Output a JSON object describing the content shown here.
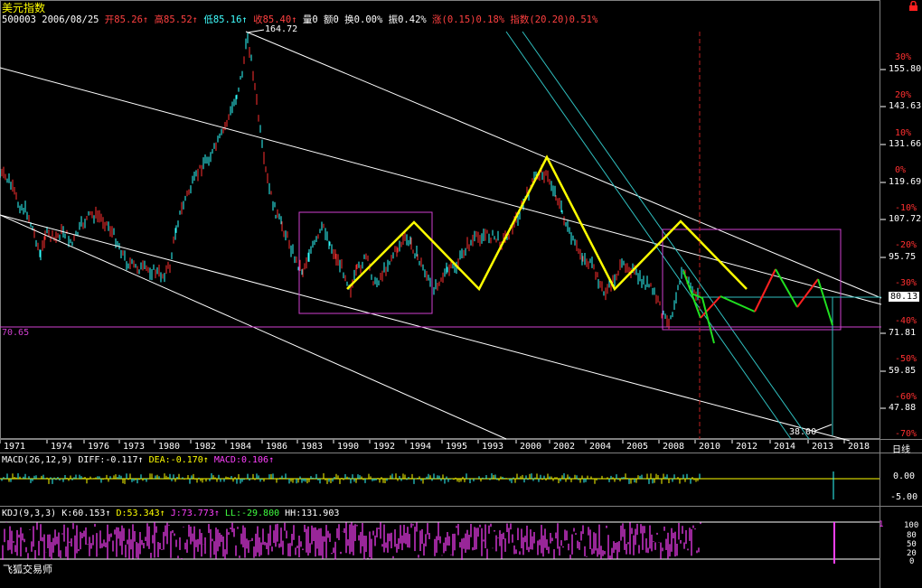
{
  "window_title": "美元指数",
  "info_bar": {
    "code_date": "500003 2006/08/25",
    "open": "开85.26↑",
    "high": "高85.52↑",
    "low": "低85.16↑",
    "close": "收85.40↑",
    "volume": "量0",
    "amount": "额0",
    "turnover": "换0.00%",
    "amplitude": "振0.42%",
    "change": "涨(0.15)0.18%",
    "index_change": "指数(20.20)0.51%"
  },
  "lock_icon": "lock-icon",
  "peak_label": "164.72",
  "trough_label": "38.00",
  "left_level_label": "70.65",
  "current_price_label": "80.13",
  "y_axis": {
    "prices": [
      "155.80",
      "143.63",
      "131.66",
      "119.69",
      "107.72",
      "95.75",
      "71.81",
      "59.85",
      "47.88"
    ],
    "percents": [
      "30%",
      "20%",
      "10%",
      "0%",
      "-10%",
      "-20%",
      "-30%",
      "-40%",
      "-50%",
      "-60%",
      "-70%"
    ]
  },
  "x_axis": {
    "years": [
      "1971",
      "1974",
      "1976",
      "1973",
      "1980",
      "1982",
      "1984",
      "1986",
      "1983",
      "1990",
      "1992",
      "1994",
      "1995",
      "1993",
      "2000",
      "2002",
      "2004",
      "2005",
      "2008",
      "2010",
      "2012",
      "2014",
      "2013",
      "2018"
    ],
    "period_button": "日线"
  },
  "macd": {
    "title": "MACD(26,12,9)",
    "diff": "DIFF:-0.117↑",
    "dea": "DEA:-0.170↑",
    "macd": "MACD:0.106↑",
    "ticks": [
      "0.00",
      "-5.00"
    ]
  },
  "kdj": {
    "title": "KDJ(9,3,3)",
    "k": "K:60.153↑",
    "d": "D:53.343↑",
    "j": "J:73.773↑",
    "ll": "LL:-29.800",
    "hh": "HH:131.903",
    "ticks": [
      "100",
      "80",
      "50",
      "20",
      "0"
    ],
    "right_marker": "1"
  },
  "watermark": "飞狐交易师",
  "colors": {
    "up": "#ff3030",
    "down": "#30ffff",
    "pattern": "#ffff00",
    "projection_up": "#ff2020",
    "projection_down": "#20e020",
    "box": "#d040d0",
    "kdj": "#ff40ff"
  }
}
